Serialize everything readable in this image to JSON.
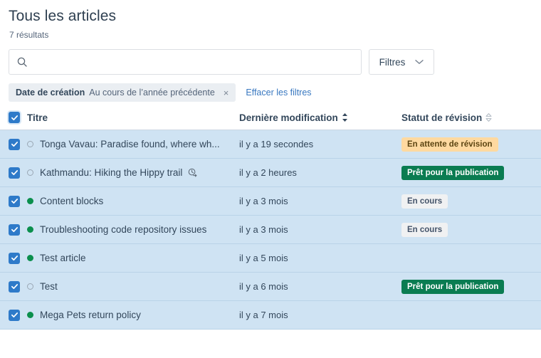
{
  "header": {
    "title": "Tous les articles",
    "result_count": "7 résultats"
  },
  "search": {
    "value": "",
    "placeholder": "",
    "icon": "search-icon"
  },
  "filters_button": {
    "label": "Filtres",
    "icon": "chevron-down-icon"
  },
  "filter_chip": {
    "key": "Date de création",
    "value": "Au cours de l’année précédente",
    "close_icon": "×"
  },
  "clear_filters_label": "Effacer les filtres",
  "table": {
    "select_all_checked": true,
    "columns": [
      {
        "label": "Titre",
        "sort": "none"
      },
      {
        "label": "Dernière modification",
        "sort": "active"
      },
      {
        "label": "Statut de révision",
        "sort": "inactive"
      }
    ],
    "rows": [
      {
        "checked": true,
        "state": "draft",
        "title": "Tonga Vavau: Paradise found, where wh...",
        "scheduled_icon": false,
        "modified": "il y a 19 secondes",
        "status": "En attente de révision",
        "status_style": "amber"
      },
      {
        "checked": true,
        "state": "draft",
        "title": "Kathmandu: Hiking the Hippy trail",
        "scheduled_icon": true,
        "modified": "il y a 2 heures",
        "status": "Prêt pour la publication",
        "status_style": "green"
      },
      {
        "checked": true,
        "state": "published",
        "title": "Content blocks",
        "scheduled_icon": false,
        "modified": "il y a 3 mois",
        "status": "En cours",
        "status_style": "gray"
      },
      {
        "checked": true,
        "state": "published",
        "title": "Troubleshooting code repository issues",
        "scheduled_icon": false,
        "modified": "il y a 3 mois",
        "status": "En cours",
        "status_style": "gray"
      },
      {
        "checked": true,
        "state": "published",
        "title": "Test article",
        "scheduled_icon": false,
        "modified": "il y a 5 mois",
        "status": "",
        "status_style": "none"
      },
      {
        "checked": true,
        "state": "draft",
        "title": "Test",
        "scheduled_icon": false,
        "modified": "il y a 6 mois",
        "status": "Prêt pour la publication",
        "status_style": "green"
      },
      {
        "checked": true,
        "state": "published",
        "title": "Mega Pets return policy",
        "scheduled_icon": false,
        "modified": "il y a 7 mois",
        "status": "",
        "status_style": "none"
      }
    ]
  },
  "colors": {
    "row_selected_bg": "#cfe3f3",
    "checkbox_blue": "#2e7ac9",
    "badge_amber_bg": "#ffd9a0",
    "badge_green_bg": "#0a7c51",
    "badge_gray_bg": "#f0f1f2",
    "published_dot": "#0b8f4d",
    "link_blue": "#3978c0"
  }
}
